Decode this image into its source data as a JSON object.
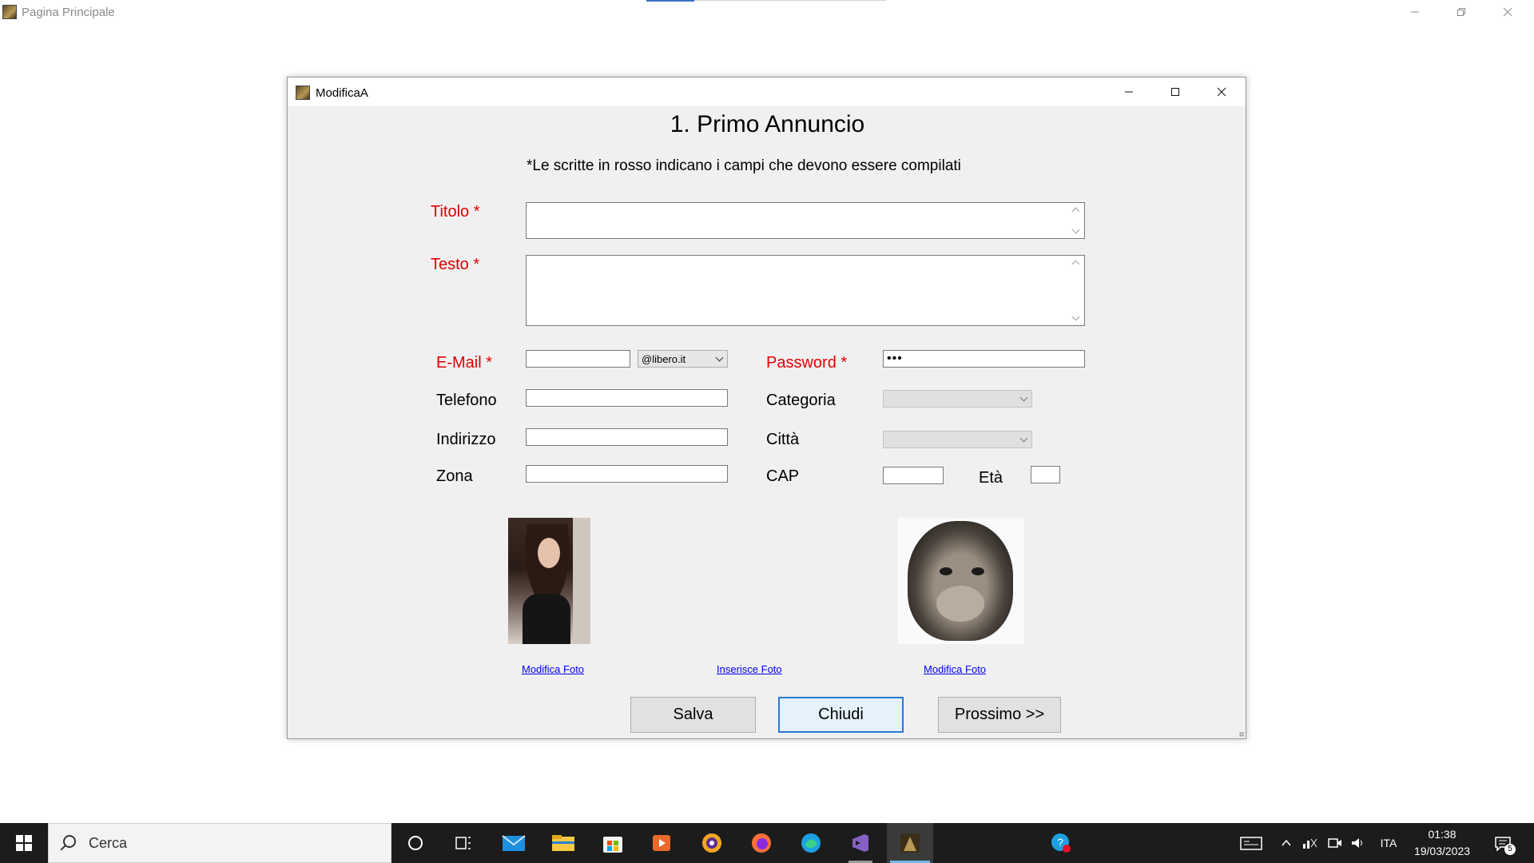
{
  "main_window": {
    "title": "Pagina Principale"
  },
  "dialog": {
    "title": "ModificaA",
    "heading": "1. Primo Annuncio",
    "note": "*Le scritte in rosso indicano i campi che devono essere compilati",
    "fields": {
      "titolo_label": "Titolo *",
      "testo_label": "Testo *",
      "email_label": "E-Mail *",
      "email_value": "",
      "email_domain": "@libero.it",
      "password_label": "Password *",
      "password_value": "•••",
      "telefono_label": "Telefono",
      "telefono_value": "",
      "categoria_label": "Categoria",
      "categoria_value": "",
      "indirizzo_label": "Indirizzo",
      "indirizzo_value": "",
      "citta_label": "Città",
      "citta_value": "",
      "zona_label": "Zona",
      "zona_value": "",
      "cap_label": "CAP",
      "cap_value": "",
      "eta_label": "Età",
      "eta_value": ""
    },
    "photos": {
      "modifica_foto_1": "Modifica Foto",
      "inserisce_foto": "Inserisce Foto",
      "modifica_foto_2": "Modifica Foto"
    },
    "buttons": {
      "salva": "Salva",
      "chiudi": "Chiudi",
      "prossimo": "Prossimo >>"
    }
  },
  "taskbar": {
    "search_placeholder": "Cerca",
    "language": "ITA",
    "time": "01:38",
    "date": "19/03/2023",
    "notification_count": "5",
    "accent_color": "#76b9ed"
  }
}
